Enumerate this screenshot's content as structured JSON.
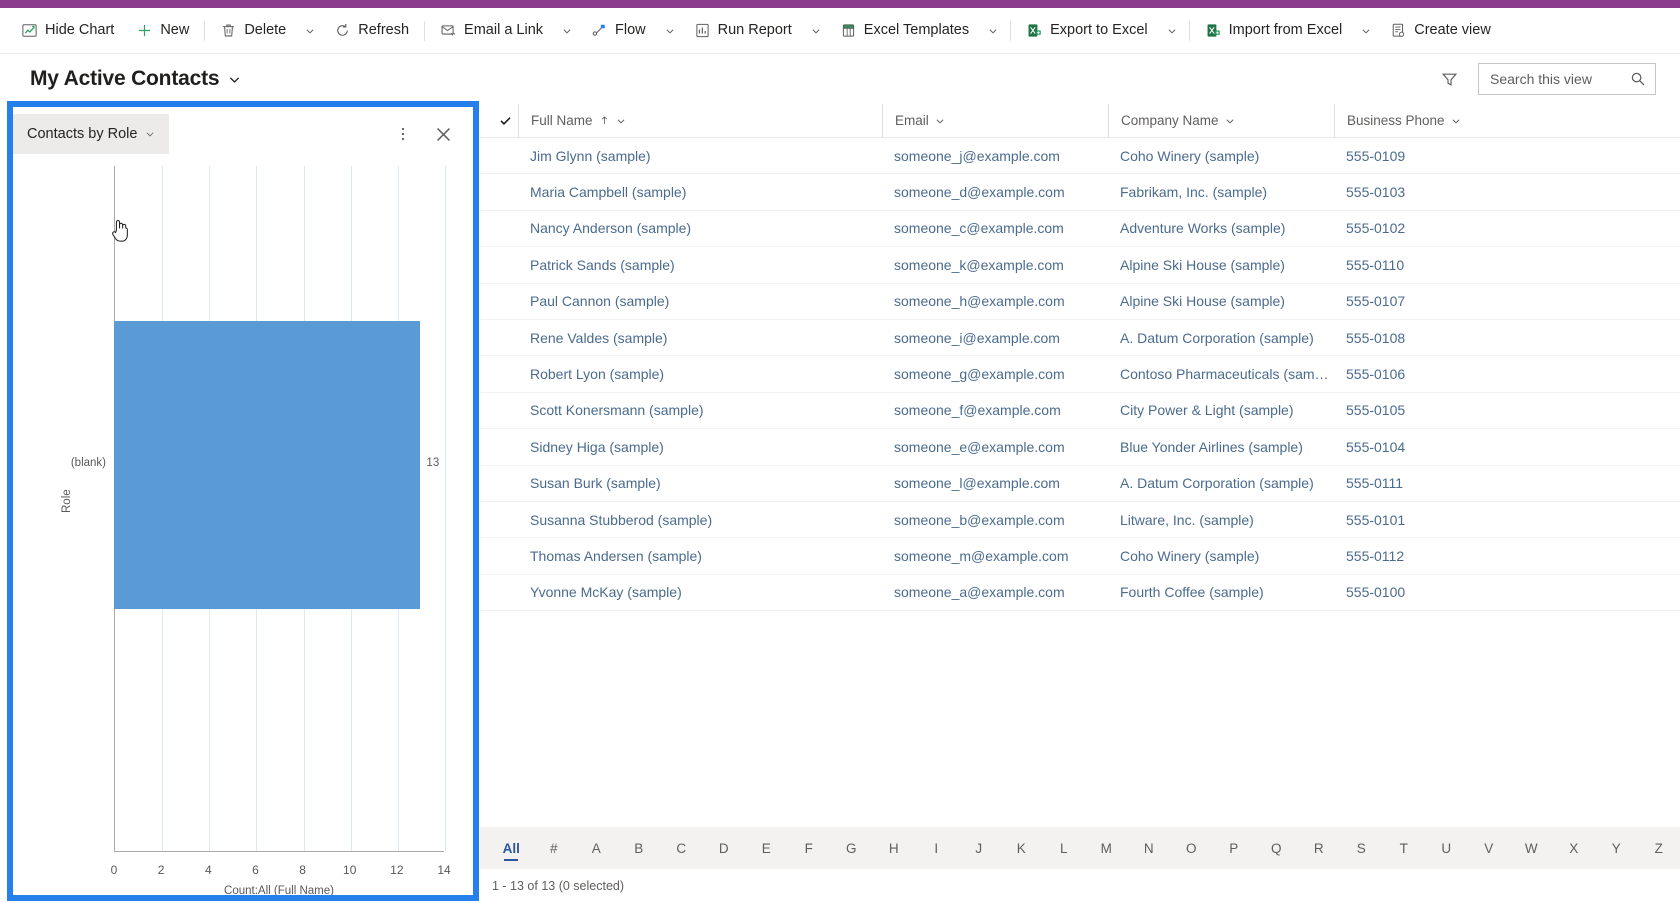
{
  "theme": {
    "brand_purple": "#8C3C8C",
    "highlight_blue": "#2680EB",
    "bar_blue": "#5B9BD5",
    "link_blue": "#4a6f96"
  },
  "command_bar": {
    "items": [
      {
        "label": "Hide Chart",
        "icon": "hide-chart-icon",
        "caret": false
      },
      {
        "label": "New",
        "icon": "plus-icon",
        "caret": false
      },
      {
        "label": "Delete",
        "icon": "trash-icon",
        "caret": true,
        "sep_before_caret": true
      },
      {
        "label": "Refresh",
        "icon": "refresh-icon",
        "caret": false
      },
      {
        "label": "Email a Link",
        "icon": "email-link-icon",
        "caret": true,
        "sep_before_caret": true
      },
      {
        "label": "Flow",
        "icon": "flow-icon",
        "caret": true
      },
      {
        "label": "Run Report",
        "icon": "run-report-icon",
        "caret": true
      },
      {
        "label": "Excel Templates",
        "icon": "excel-templates-icon",
        "caret": true
      },
      {
        "label": "Export to Excel",
        "icon": "excel-export-icon",
        "caret": true,
        "sep_before_caret": true
      },
      {
        "label": "Import from Excel",
        "icon": "excel-import-icon",
        "caret": true,
        "sep_before_caret": true
      },
      {
        "label": "Create view",
        "icon": "create-view-icon",
        "caret": false
      }
    ]
  },
  "view_header": {
    "title": "My Active Contacts",
    "title_caret_icon": "chevron-down-icon",
    "filter_icon": "filter-icon",
    "search": {
      "placeholder": "Search this view",
      "value": "",
      "icon": "search-icon"
    }
  },
  "chart_panel": {
    "name": "Contacts by Role",
    "name_caret_icon": "chevron-down-icon",
    "more_icon": "more-vertical-icon",
    "close_icon": "close-icon",
    "cursor_icon": "pointer-hand-cursor"
  },
  "chart_data": {
    "type": "bar",
    "orientation": "horizontal",
    "title": "Contacts by Role",
    "categories": [
      "(blank)"
    ],
    "values": [
      13
    ],
    "data_labels": [
      "13"
    ],
    "xlabel": "Count:All (Full Name)",
    "ylabel": "Role",
    "xlim": [
      0,
      14
    ],
    "xticks": [
      0,
      2,
      4,
      6,
      8,
      10,
      12,
      14
    ],
    "grid": true,
    "legend": "none",
    "series_color": "#5B9BD5"
  },
  "grid": {
    "select_all_icon": "checkmark-icon",
    "columns": [
      {
        "label": "Full Name",
        "sort_icon": "sort-asc-icon",
        "caret_icon": "chevron-down-icon"
      },
      {
        "label": "Email",
        "sort_icon": "",
        "caret_icon": "chevron-down-icon"
      },
      {
        "label": "Company Name",
        "sort_icon": "",
        "caret_icon": "chevron-down-icon"
      },
      {
        "label": "Business Phone",
        "sort_icon": "",
        "caret_icon": "chevron-down-icon"
      }
    ],
    "rows": [
      [
        "Jim Glynn (sample)",
        "someone_j@example.com",
        "Coho Winery (sample)",
        "555-0109"
      ],
      [
        "Maria Campbell (sample)",
        "someone_d@example.com",
        "Fabrikam, Inc. (sample)",
        "555-0103"
      ],
      [
        "Nancy Anderson (sample)",
        "someone_c@example.com",
        "Adventure Works (sample)",
        "555-0102"
      ],
      [
        "Patrick Sands (sample)",
        "someone_k@example.com",
        "Alpine Ski House (sample)",
        "555-0110"
      ],
      [
        "Paul Cannon (sample)",
        "someone_h@example.com",
        "Alpine Ski House (sample)",
        "555-0107"
      ],
      [
        "Rene Valdes (sample)",
        "someone_i@example.com",
        "A. Datum Corporation (sample)",
        "555-0108"
      ],
      [
        "Robert Lyon (sample)",
        "someone_g@example.com",
        "Contoso Pharmaceuticals (sample)",
        "555-0106"
      ],
      [
        "Scott Konersmann (sample)",
        "someone_f@example.com",
        "City Power & Light (sample)",
        "555-0105"
      ],
      [
        "Sidney Higa (sample)",
        "someone_e@example.com",
        "Blue Yonder Airlines (sample)",
        "555-0104"
      ],
      [
        "Susan Burk (sample)",
        "someone_l@example.com",
        "A. Datum Corporation (sample)",
        "555-0111"
      ],
      [
        "Susanna Stubberod (sample)",
        "someone_b@example.com",
        "Litware, Inc. (sample)",
        "555-0101"
      ],
      [
        "Thomas Andersen (sample)",
        "someone_m@example.com",
        "Coho Winery (sample)",
        "555-0112"
      ],
      [
        "Yvonne McKay (sample)",
        "someone_a@example.com",
        "Fourth Coffee (sample)",
        "555-0100"
      ]
    ]
  },
  "alpha_bar": {
    "active": "All",
    "items": [
      "All",
      "#",
      "A",
      "B",
      "C",
      "D",
      "E",
      "F",
      "G",
      "H",
      "I",
      "J",
      "K",
      "L",
      "M",
      "N",
      "O",
      "P",
      "Q",
      "R",
      "S",
      "T",
      "U",
      "V",
      "W",
      "X",
      "Y",
      "Z"
    ]
  },
  "status_bar": {
    "text": "1 - 13 of 13 (0 selected)"
  }
}
